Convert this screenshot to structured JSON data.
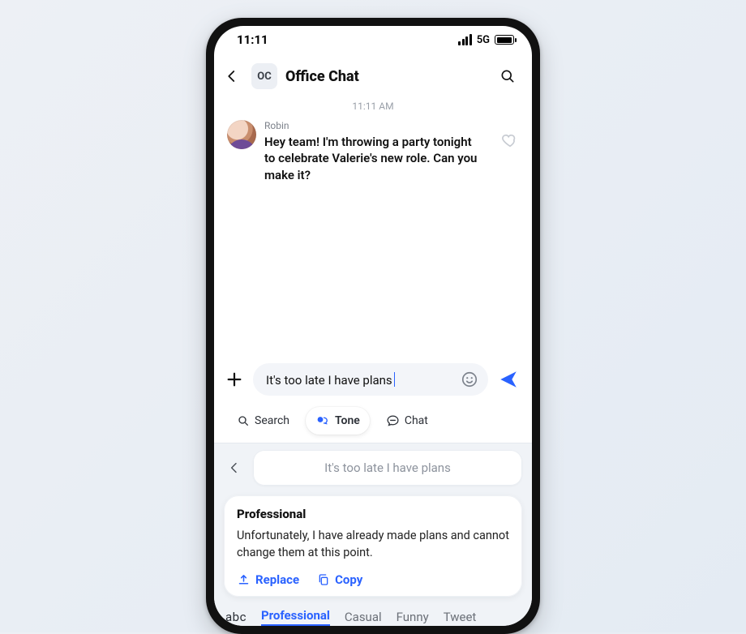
{
  "statusbar": {
    "time": "11:11",
    "network": "5G"
  },
  "header": {
    "badge": "OC",
    "title": "Office Chat"
  },
  "thread": {
    "timestamp": "11:11 AM",
    "sender": "Robin",
    "text": "Hey team! I'm throwing a party tonight to celebrate Valerie's new role. Can you make it?"
  },
  "compose": {
    "value": "It's too late I have plans"
  },
  "ai_tabs": {
    "search": "Search",
    "tone": "Tone",
    "chat": "Chat"
  },
  "echo": "It's too late I have plans",
  "suggestion": {
    "heading": "Professional",
    "body": "Unfortunately, I have already made plans and cannot change them at this point.",
    "replace": "Replace",
    "copy": "Copy"
  },
  "tone_tabs": {
    "abc": "abc",
    "items": [
      "Professional",
      "Casual",
      "Funny",
      "Tweet"
    ],
    "selected": 0
  }
}
